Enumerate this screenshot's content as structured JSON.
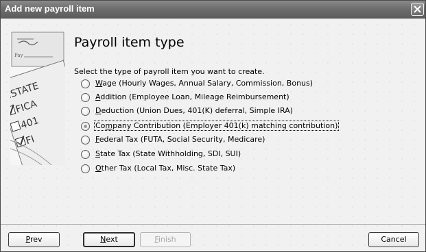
{
  "window": {
    "title": "Add new payroll item",
    "close_icon": "close-icon"
  },
  "art": {
    "labels": [
      "STATE",
      "FICA",
      "401",
      "FI"
    ]
  },
  "main": {
    "heading": "Payroll item type",
    "instruction": "Select the type of payroll item you want to create.",
    "options": [
      {
        "accel": "W",
        "rest": "age (Hourly Wages, Annual Salary, Commission, Bonus)",
        "checked": false
      },
      {
        "accel": "A",
        "rest": "ddition (Employee Loan, Mileage Reimbursement)",
        "checked": false
      },
      {
        "accel": "D",
        "rest": "eduction (Union Dues, 401(K) deferral, Simple IRA)",
        "checked": false
      },
      {
        "pre": "Co",
        "accel": "m",
        "rest": "pany Contribution (Employer 401(k) matching contribution)",
        "checked": true
      },
      {
        "accel": "F",
        "rest": "ederal Tax (FUTA, Social Security, Medicare)",
        "checked": false
      },
      {
        "accel": "S",
        "rest": "tate Tax (State Withholding, SDI, SUI)",
        "checked": false
      },
      {
        "accel": "O",
        "rest": "ther Tax (Local Tax, Misc. State Tax)",
        "checked": false
      }
    ]
  },
  "buttons": {
    "prev": {
      "accel": "P",
      "rest": "rev"
    },
    "next": {
      "accel": "N",
      "rest": "ext"
    },
    "finish": {
      "accel": "F",
      "rest": "inish"
    },
    "cancel": {
      "label": "Cancel"
    }
  }
}
